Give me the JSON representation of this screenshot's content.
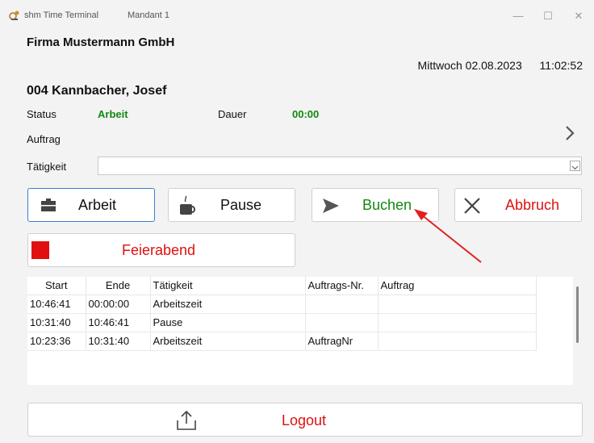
{
  "window": {
    "title": "shm Time Terminal",
    "mandant": "Mandant 1",
    "controls": [
      "—",
      "☐",
      "✕"
    ]
  },
  "header": {
    "company": "Firma Mustermann GmbH",
    "weekday_date": "Mittwoch 02.08.2023",
    "time": "11:02:52",
    "employee": "004  Kannbacher, Josef"
  },
  "status": {
    "status_label": "Status",
    "status_value": "Arbeit",
    "duration_label": "Dauer",
    "duration_value": "00:00",
    "auftrag_label": "Auftrag",
    "taetigkeit_label": "Tätigkeit",
    "taetigkeit_value": ""
  },
  "buttons": {
    "arbeit": "Arbeit",
    "pause": "Pause",
    "buchen": "Buchen",
    "abbruch": "Abbruch",
    "feierabend": "Feierabend",
    "logout": "Logout"
  },
  "colors": {
    "green": "#118811",
    "red": "#e01010",
    "accent_blue": "#3b7fd0",
    "arrow_red": "#e02020"
  },
  "table": {
    "columns": [
      "Start",
      "Ende",
      "Tätigkeit",
      "Auftrags-Nr.",
      "Auftrag"
    ],
    "rows": [
      [
        "10:46:41",
        "00:00:00",
        "Arbeitszeit",
        "",
        ""
      ],
      [
        "10:31:40",
        "10:46:41",
        "Pause",
        "",
        ""
      ],
      [
        "10:23:36",
        "10:31:40",
        "Arbeitszeit",
        "AuftragNr",
        ""
      ]
    ]
  }
}
